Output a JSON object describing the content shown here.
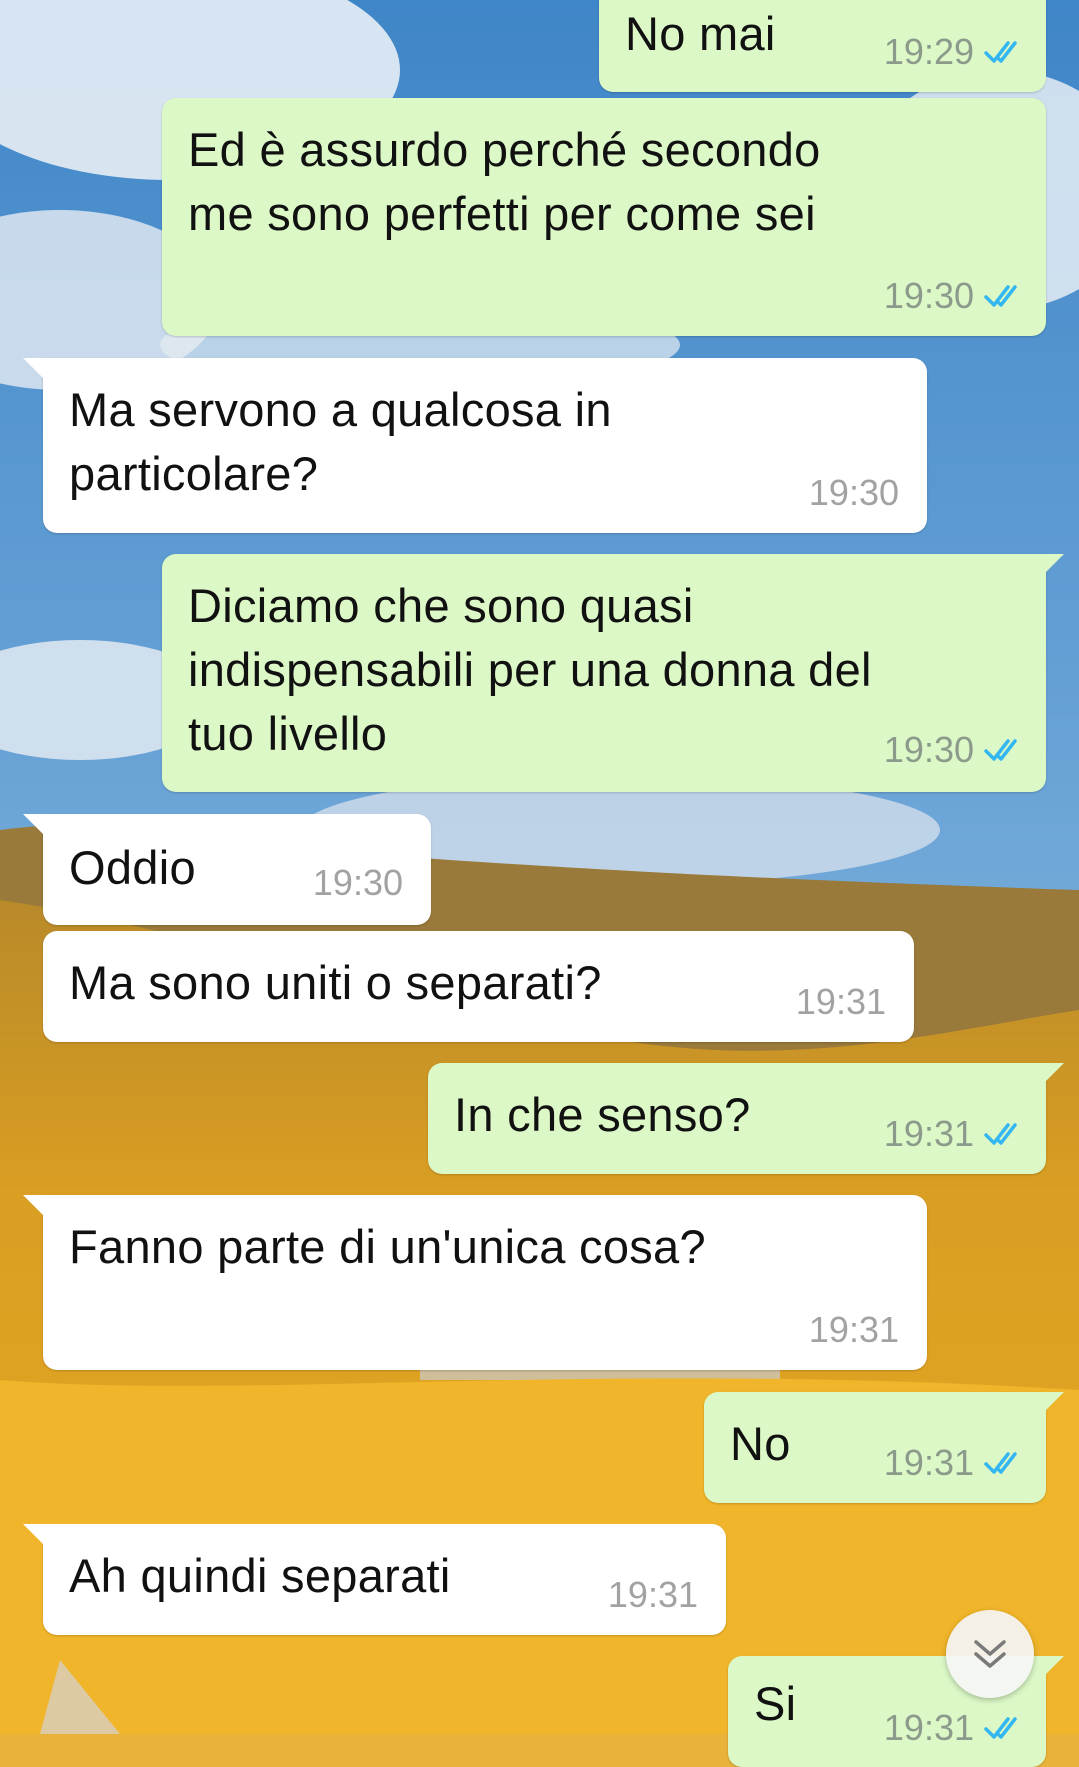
{
  "colors": {
    "outgoing_bubble": "#dcf8c6",
    "incoming_bubble": "#ffffff",
    "read_ticks": "#34b7f1",
    "timestamp": "#8c9a8c"
  },
  "messages": [
    {
      "direction": "outgoing",
      "text": "No mai",
      "time": "19:29",
      "status": "read"
    },
    {
      "direction": "outgoing",
      "text": "Ed è assurdo perché secondo\nme sono perfetti per come sei",
      "time": "19:30",
      "status": "read"
    },
    {
      "direction": "incoming",
      "text": "Ma servono a qualcosa in\nparticolare?",
      "time": "19:30"
    },
    {
      "direction": "outgoing",
      "text": "Diciamo che sono quasi\nindispensabili per una donna del\ntuo livello",
      "time": "19:30",
      "status": "read"
    },
    {
      "direction": "incoming",
      "text": "Oddio",
      "time": "19:30"
    },
    {
      "direction": "incoming",
      "text": "Ma sono uniti o separati?",
      "time": "19:31"
    },
    {
      "direction": "outgoing",
      "text": "In che senso?",
      "time": "19:31",
      "status": "read"
    },
    {
      "direction": "incoming",
      "text": "Fanno parte di un'unica cosa?",
      "time": "19:31"
    },
    {
      "direction": "outgoing",
      "text": "No",
      "time": "19:31",
      "status": "read"
    },
    {
      "direction": "incoming",
      "text": "Ah quindi separati",
      "time": "19:31"
    },
    {
      "direction": "outgoing",
      "text": "Si",
      "time": "19:31",
      "status": "read"
    }
  ],
  "icons": {
    "read_receipt": "double-check-icon",
    "scroll_down": "chevron-double-down-icon"
  }
}
